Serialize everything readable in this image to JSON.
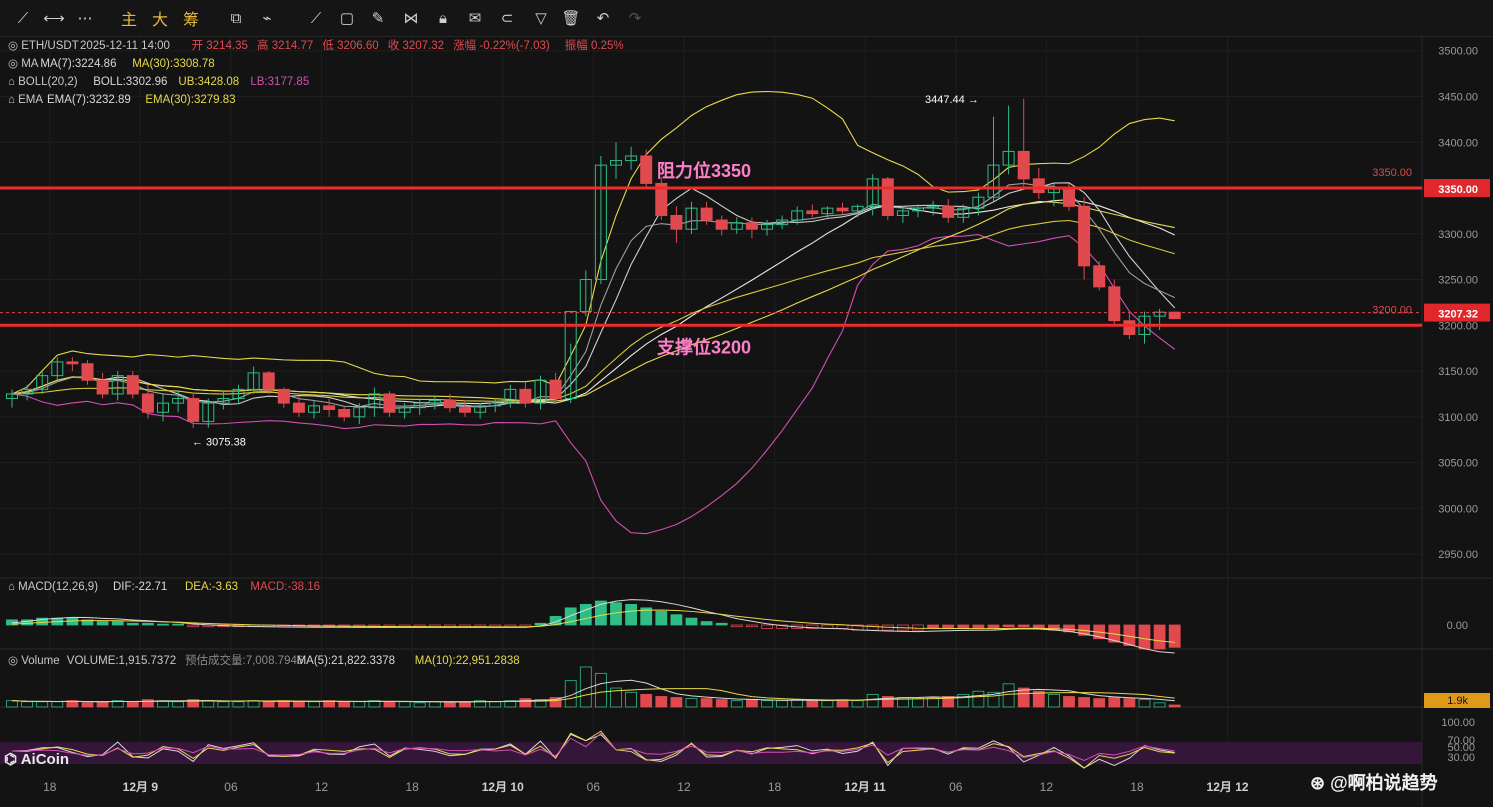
{
  "toolbar": {
    "modes": [
      "主",
      "大",
      "筹"
    ],
    "icons": [
      "crosshair-icon",
      "horizontal-line-icon",
      "more-dots-icon",
      "indicator-icon",
      "ruler-icon",
      "trend-line-icon",
      "rectangle-icon",
      "brush-icon",
      "pattern-icon",
      "lock-icon",
      "note-icon",
      "magnet-icon",
      "filter-icon",
      "trash-icon",
      "undo-icon",
      "redo-icon"
    ]
  },
  "legend": {
    "symbol": "ETH/USDT",
    "datetime": "2025-12-11 14:00",
    "open_label": "开",
    "open": "3214.35",
    "high_label": "高",
    "high": "3214.77",
    "low_label": "低",
    "low": "3206.60",
    "close_label": "收",
    "close": "3207.32",
    "change_label": "涨幅",
    "change": "-0.22%(-7.03)",
    "amp_label": "振幅",
    "amp": "0.25%",
    "ma_name": "MA",
    "ma7": "MA(7):3224.86",
    "ma30": "MA(30):3308.78",
    "boll_name": "BOLL(20,2)",
    "boll": "BOLL:3302.96",
    "ub": "UB:3428.08",
    "lb": "LB:3177.85",
    "ema_name": "EMA",
    "ema7": "EMA(7):3232.89",
    "ema30": "EMA(30):3279.83",
    "macd_name": "MACD(12,26,9)",
    "dif": "DIF:-22.71",
    "dea": "DEA:-3.63",
    "macd": "MACD:-38.16",
    "vol_name": "Volume",
    "vol": "VOLUME:1,915.7372",
    "vol_est": "预估成交量:7,008.7946",
    "vol_ma5": "MA(5):21,822.3378",
    "vol_ma10": "MA(10):22,951.2838"
  },
  "annotations": {
    "resistance": "阻力位3350",
    "support": "支撑位3200",
    "high_mark": "3447.44",
    "low_mark": "3075.38",
    "line_3350": "3350.00",
    "line_3200": "3200.00",
    "price_tag_3350": "3350.00",
    "price_tag_last": "3207.32",
    "vol_tag": "1.9k"
  },
  "watermark": {
    "brand": "AiCoin",
    "author": "@啊柏说趋势"
  },
  "colors": {
    "up": "#2ebd85",
    "down": "#e04a4f",
    "boll_mid": "#e8e8e8",
    "boll_ub": "#e8d94a",
    "boll_lb": "#d24fb5",
    "hline": "#f02b2b",
    "annot": "#ff7fc8"
  },
  "chart_data": {
    "type": "candlestick",
    "symbol": "ETH/USDT",
    "interval": "1h",
    "ylim": [
      2925,
      3515
    ],
    "y_ticks": [
      "3500.00",
      "3450.00",
      "3400.00",
      "3350.00",
      "3300.00",
      "3250.00",
      "3200.00",
      "3150.00",
      "3100.00",
      "3050.00",
      "3000.00",
      "2950.00"
    ],
    "x_ticks": [
      {
        "label": "18",
        "bar": 2.5
      },
      {
        "label": "12月 9",
        "bar": 8.5
      },
      {
        "label": "06",
        "bar": 14.5
      },
      {
        "label": "12",
        "bar": 20.5
      },
      {
        "label": "18",
        "bar": 26.5
      },
      {
        "label": "12月 10",
        "bar": 32.5
      },
      {
        "label": "06",
        "bar": 38.5
      },
      {
        "label": "12",
        "bar": 44.5
      },
      {
        "label": "18",
        "bar": 50.5
      },
      {
        "label": "12月 11",
        "bar": 56.5
      },
      {
        "label": "06",
        "bar": 62.5
      },
      {
        "label": "12",
        "bar": 68.5
      },
      {
        "label": "18",
        "bar": 74.5
      },
      {
        "label": "12月 12",
        "bar": 80.5
      }
    ],
    "candles": [
      [
        3120,
        3130,
        3110,
        3125
      ],
      [
        3125,
        3135,
        3118,
        3130
      ],
      [
        3130,
        3150,
        3125,
        3145
      ],
      [
        3145,
        3165,
        3140,
        3160
      ],
      [
        3160,
        3165,
        3150,
        3158
      ],
      [
        3158,
        3162,
        3135,
        3140
      ],
      [
        3140,
        3148,
        3120,
        3125
      ],
      [
        3125,
        3150,
        3118,
        3145
      ],
      [
        3145,
        3150,
        3120,
        3125
      ],
      [
        3125,
        3135,
        3098,
        3105
      ],
      [
        3105,
        3125,
        3095,
        3115
      ],
      [
        3115,
        3128,
        3105,
        3120
      ],
      [
        3120,
        3125,
        3088,
        3095
      ],
      [
        3095,
        3120,
        3088,
        3115
      ],
      [
        3115,
        3128,
        3108,
        3120
      ],
      [
        3120,
        3135,
        3115,
        3130
      ],
      [
        3130,
        3155,
        3125,
        3148
      ],
      [
        3148,
        3150,
        3125,
        3130
      ],
      [
        3130,
        3132,
        3110,
        3115
      ],
      [
        3115,
        3122,
        3100,
        3105
      ],
      [
        3105,
        3118,
        3098,
        3112
      ],
      [
        3112,
        3120,
        3100,
        3108
      ],
      [
        3108,
        3112,
        3095,
        3100
      ],
      [
        3100,
        3115,
        3092,
        3110
      ],
      [
        3110,
        3132,
        3100,
        3125
      ],
      [
        3125,
        3128,
        3100,
        3105
      ],
      [
        3105,
        3115,
        3098,
        3110
      ],
      [
        3110,
        3120,
        3102,
        3115
      ],
      [
        3115,
        3122,
        3108,
        3118
      ],
      [
        3118,
        3125,
        3105,
        3110
      ],
      [
        3110,
        3118,
        3100,
        3105
      ],
      [
        3105,
        3115,
        3098,
        3112
      ],
      [
        3112,
        3120,
        3105,
        3115
      ],
      [
        3115,
        3135,
        3110,
        3130
      ],
      [
        3130,
        3138,
        3110,
        3115
      ],
      [
        3115,
        3145,
        3108,
        3140
      ],
      [
        3140,
        3148,
        3115,
        3120
      ],
      [
        3120,
        3180,
        3115,
        3215
      ],
      [
        3215,
        3260,
        3210,
        3250
      ],
      [
        3250,
        3385,
        3245,
        3375
      ],
      [
        3375,
        3400,
        3360,
        3380
      ],
      [
        3380,
        3395,
        3370,
        3385
      ],
      [
        3385,
        3392,
        3350,
        3355
      ],
      [
        3355,
        3362,
        3315,
        3320
      ],
      [
        3320,
        3330,
        3290,
        3305
      ],
      [
        3305,
        3335,
        3300,
        3328
      ],
      [
        3328,
        3335,
        3310,
        3315
      ],
      [
        3315,
        3320,
        3298,
        3305
      ],
      [
        3305,
        3318,
        3300,
        3312
      ],
      [
        3312,
        3318,
        3295,
        3305
      ],
      [
        3305,
        3315,
        3298,
        3310
      ],
      [
        3310,
        3320,
        3305,
        3315
      ],
      [
        3315,
        3330,
        3310,
        3325
      ],
      [
        3325,
        3332,
        3318,
        3322
      ],
      [
        3322,
        3330,
        3316,
        3328
      ],
      [
        3328,
        3334,
        3320,
        3325
      ],
      [
        3325,
        3332,
        3318,
        3330
      ],
      [
        3330,
        3365,
        3320,
        3360
      ],
      [
        3360,
        3362,
        3315,
        3320
      ],
      [
        3320,
        3330,
        3312,
        3325
      ],
      [
        3325,
        3332,
        3318,
        3328
      ],
      [
        3328,
        3336,
        3320,
        3330
      ],
      [
        3330,
        3338,
        3312,
        3318
      ],
      [
        3318,
        3332,
        3312,
        3328
      ],
      [
        3328,
        3345,
        3320,
        3340
      ],
      [
        3340,
        3428,
        3335,
        3375
      ],
      [
        3375,
        3440,
        3365,
        3390
      ],
      [
        3390,
        3447.44,
        3350,
        3360
      ],
      [
        3360,
        3372,
        3338,
        3345
      ],
      [
        3345,
        3355,
        3330,
        3350
      ],
      [
        3350,
        3355,
        3325,
        3330
      ],
      [
        3330,
        3340,
        3250,
        3265
      ],
      [
        3265,
        3270,
        3238,
        3242
      ],
      [
        3242,
        3250,
        3200,
        3205
      ],
      [
        3205,
        3215,
        3185,
        3190
      ],
      [
        3190,
        3215,
        3180,
        3210
      ],
      [
        3210,
        3218,
        3195,
        3214.35
      ],
      [
        3214.35,
        3214.77,
        3206.6,
        3207.32
      ]
    ],
    "volume": [
      6,
      5,
      5,
      5,
      6,
      4,
      5,
      6,
      5,
      7,
      6,
      5,
      7,
      6,
      5,
      5,
      6,
      5,
      6,
      5,
      5,
      6,
      5,
      5,
      6,
      5,
      5,
      4,
      5,
      5,
      5,
      6,
      5,
      6,
      8,
      7,
      9,
      25,
      38,
      32,
      18,
      14,
      12,
      10,
      9,
      8,
      8,
      7,
      6,
      7,
      6,
      6,
      7,
      6,
      6,
      7,
      6,
      12,
      10,
      9,
      8,
      9,
      10,
      12,
      15,
      14,
      22,
      18,
      15,
      12,
      10,
      9,
      8,
      9,
      8,
      7,
      4,
      1.9
    ],
    "macd_hist": [
      3,
      3,
      4,
      4,
      4,
      3,
      2,
      2,
      1,
      1,
      0.5,
      0.5,
      -1,
      -1,
      -1,
      -1,
      -1,
      -1,
      -1,
      -1,
      -1,
      -1,
      -1,
      -1,
      -1,
      -1,
      -1,
      -1,
      -1,
      -1,
      -1,
      -1,
      -1,
      -1,
      -1,
      1,
      5,
      10,
      12,
      14,
      13,
      12,
      10,
      8,
      6,
      4,
      2,
      1,
      -1,
      -1,
      -2,
      -2,
      -2,
      -2,
      -2,
      -2,
      -3,
      -3,
      -3,
      -3,
      -3,
      -2,
      -2,
      -2,
      -2,
      -2,
      -1,
      -1,
      -2,
      -3,
      -4,
      -6,
      -8,
      -10,
      -12,
      -14,
      -14,
      -13
    ],
    "horizontal_lines": [
      3350,
      3200
    ]
  }
}
